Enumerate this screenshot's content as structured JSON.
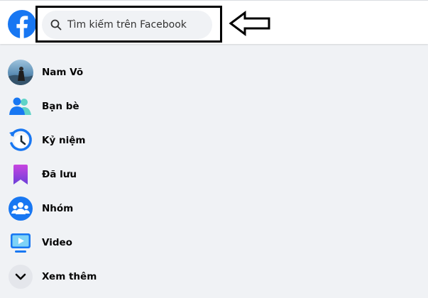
{
  "app": {
    "brand_color": "#1877f2"
  },
  "header": {
    "logo_icon": "facebook-logo-icon",
    "search": {
      "placeholder": "Tìm kiếm trên Facebook",
      "icon": "search-icon"
    },
    "annotation_arrow_icon": "left-arrow-icon"
  },
  "sidebar": {
    "items": [
      {
        "label": "Nam Võ",
        "icon": "avatar"
      },
      {
        "label": "Bạn bè",
        "icon": "friends-icon"
      },
      {
        "label": "Kỷ niệm",
        "icon": "memories-clock-icon"
      },
      {
        "label": "Đã lưu",
        "icon": "saved-bookmark-icon"
      },
      {
        "label": "Nhóm",
        "icon": "groups-icon"
      },
      {
        "label": "Video",
        "icon": "video-icon"
      },
      {
        "label": "Xem thêm",
        "icon": "chevron-down-icon"
      }
    ]
  }
}
